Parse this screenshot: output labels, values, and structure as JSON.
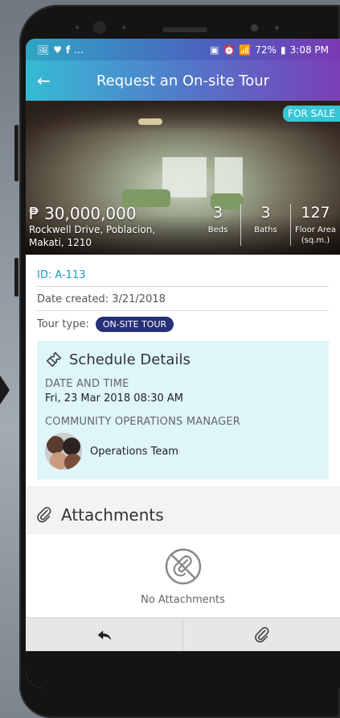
{
  "status_bar": {
    "notif_dots": "...",
    "battery": "72%",
    "time": "3:08 PM"
  },
  "app_bar": {
    "title": "Request an On-site Tour",
    "back_icon": "arrow-left-icon"
  },
  "listing": {
    "sale_badge": "FOR SALE",
    "price": "₱ 30,000,000",
    "address_line1": "Rockwell Drive, Poblacion,",
    "address_line2": "Makati, 1210",
    "stats": [
      {
        "value": "3",
        "label": "Beds",
        "label2": ""
      },
      {
        "value": "3",
        "label": "Baths",
        "label2": ""
      },
      {
        "value": "127",
        "label": "Floor Area",
        "label2": "(sq.m.)"
      }
    ]
  },
  "details": {
    "id": "ID: A-113",
    "date_created": "Date created: 3/21/2018",
    "tour_type_label": "Tour type:",
    "tour_type_value": "ON-SITE TOUR"
  },
  "schedule": {
    "heading": "Schedule Details",
    "date_label": "DATE AND TIME",
    "date_value": "Fri, 23 Mar 2018 08:30 AM",
    "manager_label": "COMMUNITY OPERATIONS MANAGER",
    "manager_name": "Operations Team"
  },
  "attachments": {
    "heading": "Attachments",
    "empty_text": "No Attachments"
  },
  "colors": {
    "accent": "#1b9dbe",
    "chip": "#262f78",
    "schedule_bg": "#def5f9"
  }
}
